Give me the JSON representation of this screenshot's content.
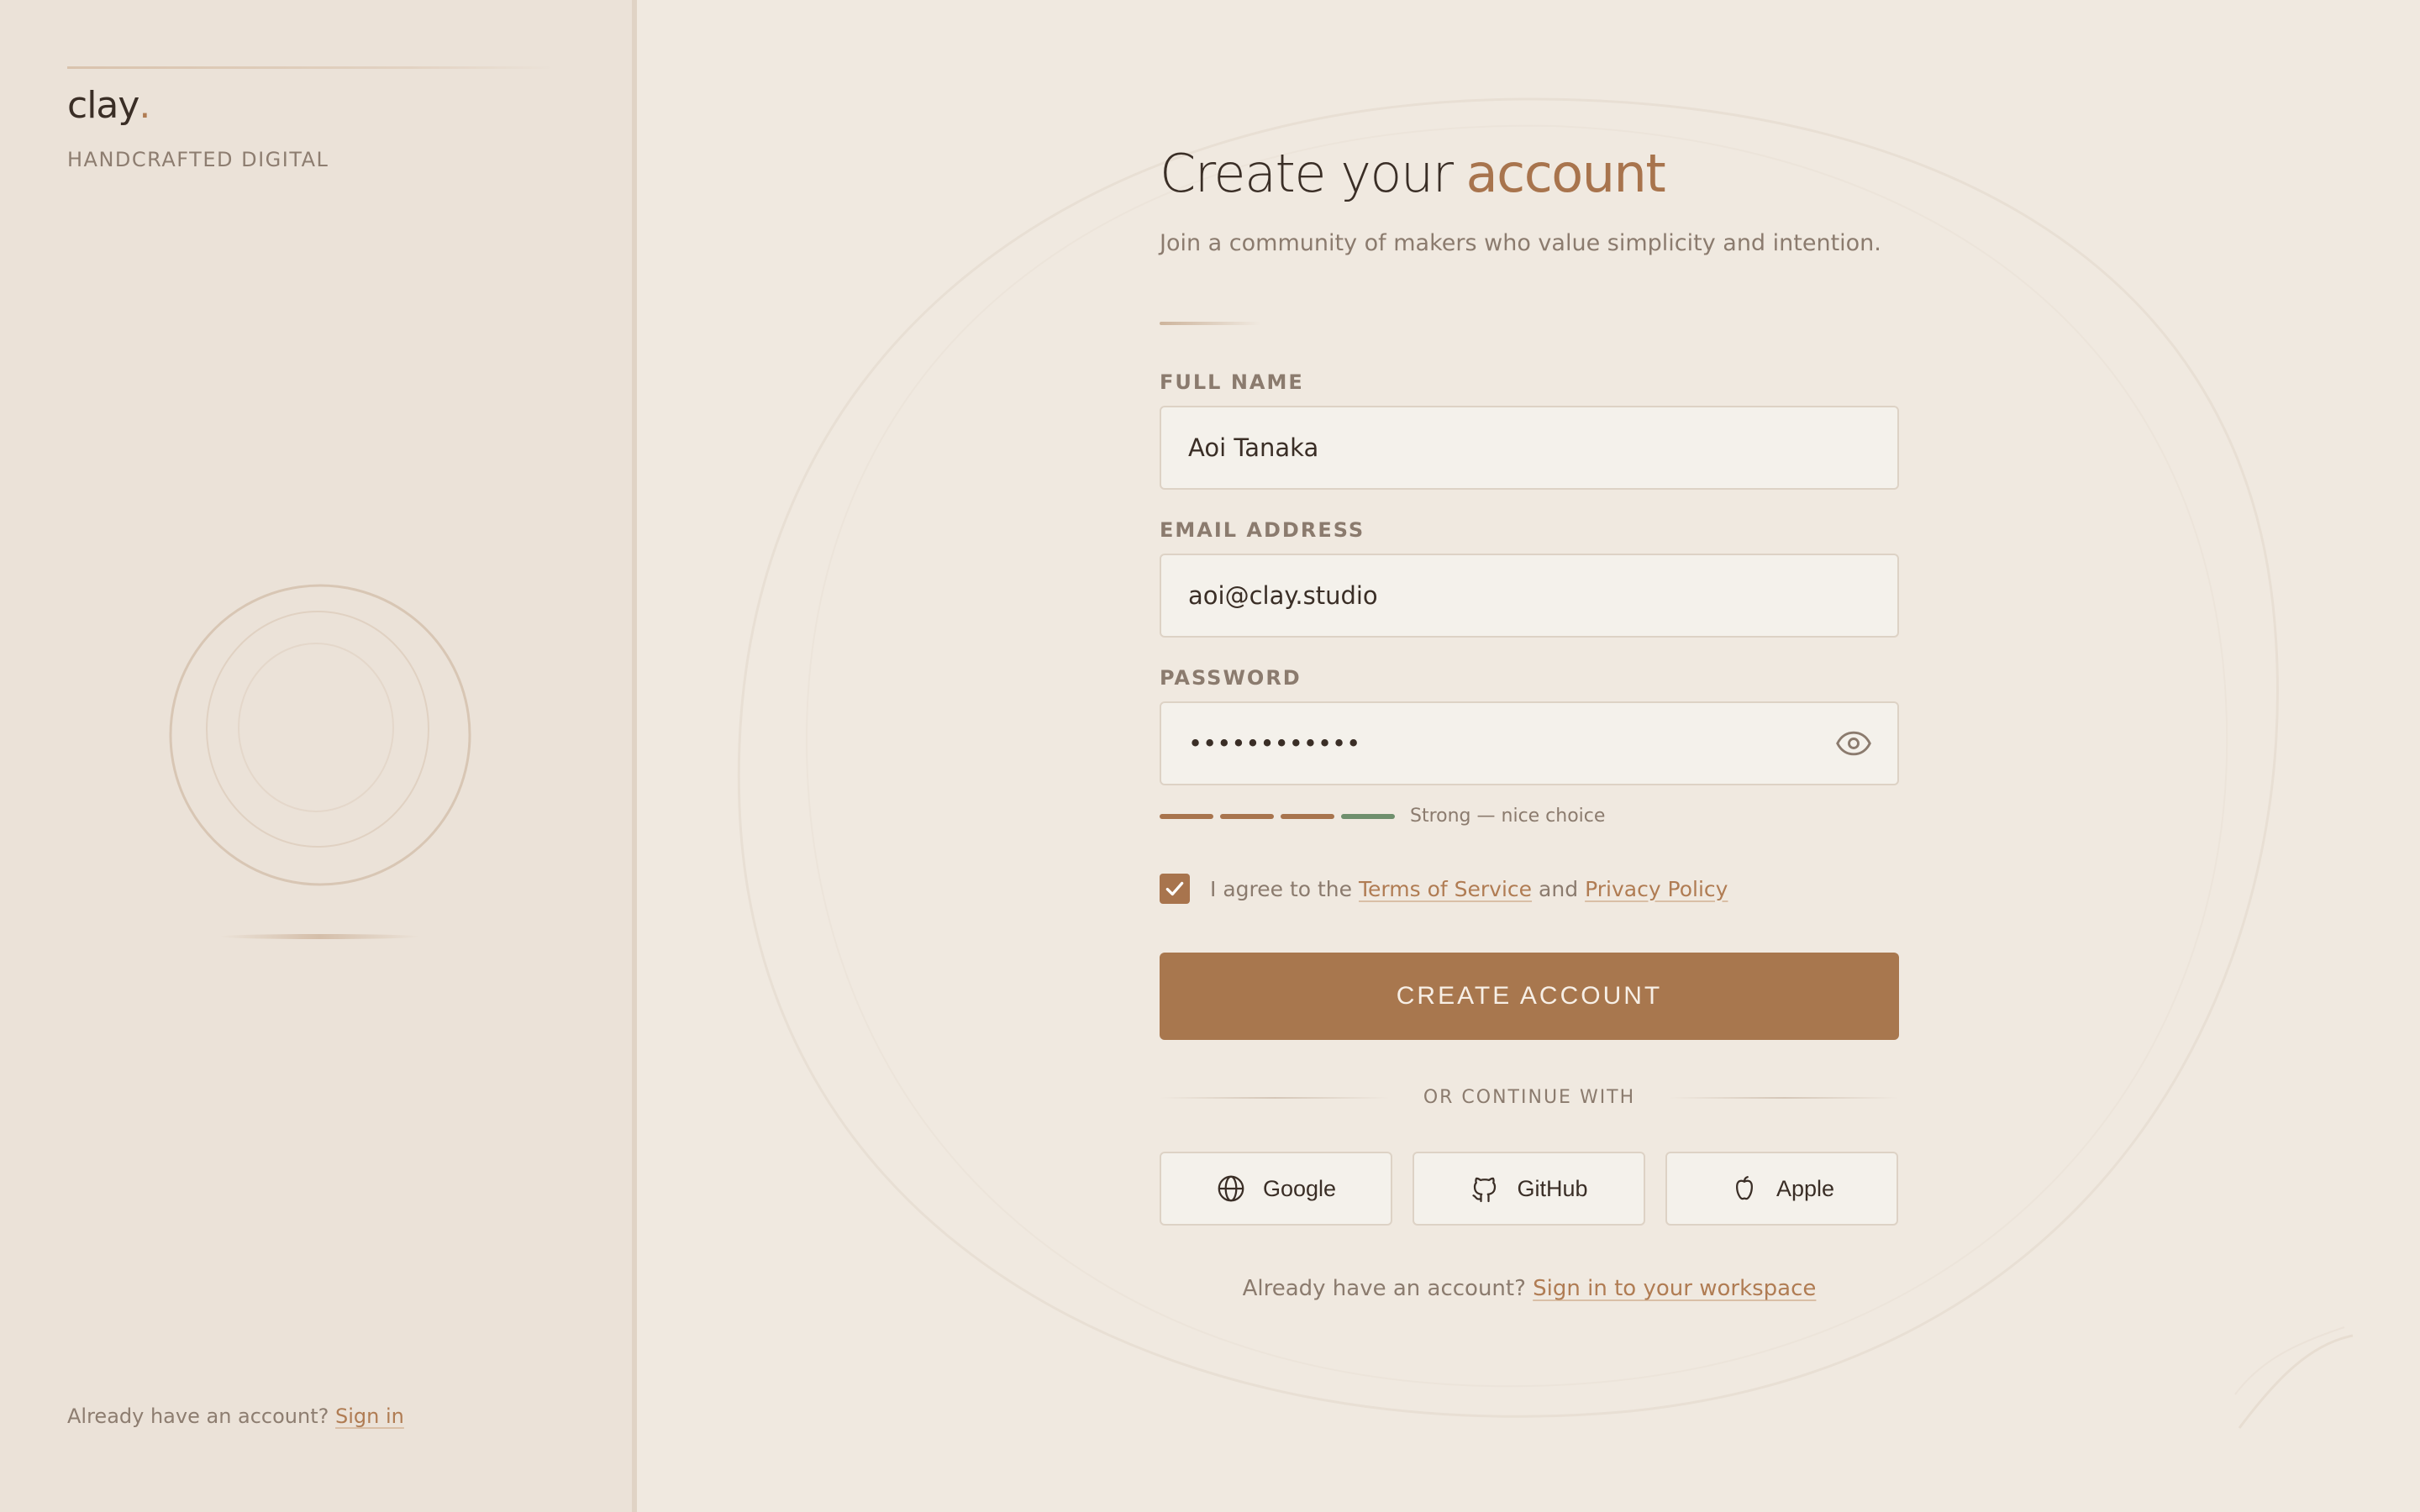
{
  "sidebar": {
    "logo": "clay",
    "logo_dot": ".",
    "tagline": "HANDCRAFTED DIGITAL",
    "footer_prompt": "Already have an account?",
    "footer_link": "Sign in"
  },
  "main": {
    "heading_prefix": "Create your",
    "heading_accent": "account",
    "subheading": "Join a community of makers who value simplicity and intention.",
    "fields": {
      "full_name": {
        "label": "FULL NAME",
        "value": "Aoi Tanaka"
      },
      "email": {
        "label": "EMAIL ADDRESS",
        "value": "aoi@clay.studio"
      },
      "password": {
        "label": "PASSWORD",
        "value": "••••••••••••",
        "icon": "eye-icon"
      }
    },
    "password_strength": {
      "level": 4,
      "max": 4,
      "label": "Strong — nice choice",
      "colors": [
        "#a8744d",
        "#a8744d",
        "#a8744d",
        "#6f8f6d"
      ]
    },
    "agree": {
      "checked": true,
      "prefix": "I agree to the",
      "terms_link": "Terms of Service",
      "conjunction": "and",
      "privacy_link": "Privacy Policy"
    },
    "submit_label": "CREATE ACCOUNT",
    "divider_label": "OR CONTINUE WITH",
    "social": [
      {
        "label": "Google",
        "icon": "globe-icon"
      },
      {
        "label": "GitHub",
        "icon": "github-icon"
      },
      {
        "label": "Apple",
        "icon": "apple-icon"
      }
    ],
    "bottom_prompt": "Already have an account?",
    "bottom_link": "Sign in to your workspace"
  },
  "colors": {
    "accent": "#a8744d",
    "background": "#f0e9e0",
    "sidebar": "#ebe2d8",
    "strength_strong": "#6f8f6d"
  }
}
